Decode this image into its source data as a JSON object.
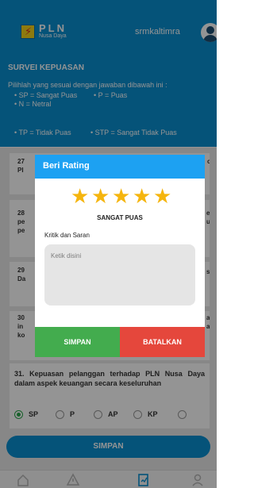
{
  "header": {
    "brand": "PLN",
    "brand_sub": "Nusa Daya",
    "username": "srmkaltimra"
  },
  "survey": {
    "title": "SURVEI KEPUASAN",
    "instruction": "Pilihlah yang sesuai dengan jawaban dibawah ini :",
    "legend": [
      "• SP = Sangat Puas",
      "• P = Puas",
      "• N = Netral",
      "• TP = Tidak Puas",
      "• STP = Sangat Tidak Puas"
    ]
  },
  "background_questions": {
    "q27_number": "27",
    "q27_frag_a": "PI",
    "q27_frag_b": "ce",
    "q28_number": "28",
    "q28_lines": [
      "pe",
      "pe"
    ],
    "q28_frag": [
      "en",
      "ur"
    ],
    "q29_number": "29",
    "q29_frag_a": "Da",
    "q29_frag_b": "sa",
    "q30_number": "30",
    "q30_lines": [
      "in",
      "ko"
    ],
    "q30_frag": [
      "an",
      "ai"
    ]
  },
  "question31": {
    "text": "31. Kepuasan pelanggan terhadap PLN Nusa Daya dalam aspek keuangan secara keseluruhan",
    "options": [
      "SP",
      "P",
      "AP",
      "KP"
    ],
    "selected": "SP"
  },
  "main_save_label": "SIMPAN",
  "dialog": {
    "title": "Beri Rating",
    "rating": 5,
    "rating_max": 5,
    "rating_label": "SANGAT PUAS",
    "comment_label": "Kritik dan Saran",
    "comment_placeholder": "Ketik disini",
    "save_label": "SIMPAN",
    "cancel_label": "BATALKAN"
  },
  "colors": {
    "primary": "#0a8fd1",
    "dialog_header": "#1da1f2",
    "star": "#f5b50e",
    "save": "#43ac4e",
    "cancel": "#e5473c",
    "radio_selected": "#2aa84a"
  },
  "bottom_nav": {
    "icons": [
      "home-icon",
      "warning-icon",
      "survey-icon",
      "profile-icon"
    ],
    "active_index": 2
  }
}
